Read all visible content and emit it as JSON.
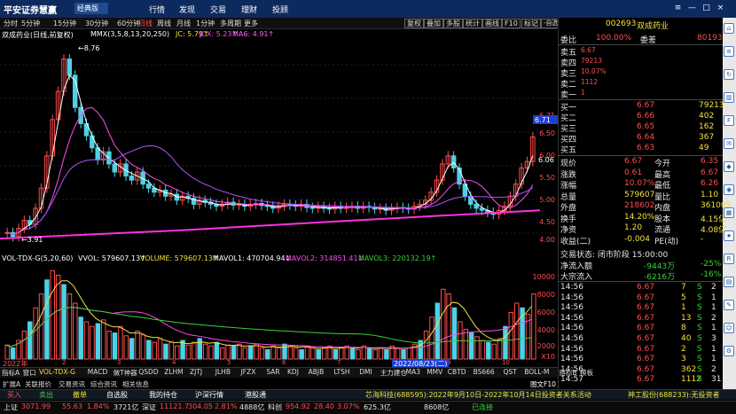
{
  "app": {
    "title": "平安证券慧赢",
    "edition": "经典版",
    "nav": [
      "行情",
      "发现",
      "交易",
      "理财",
      "投顾"
    ],
    "window_buttons": [
      "≡",
      "—",
      "□",
      "×"
    ]
  },
  "toolbar": {
    "periods": [
      "分时",
      "5分钟",
      "15分钟",
      "30分钟",
      "60分钟",
      "日线",
      "周线",
      "月线",
      "1分钟",
      "多周期",
      "更多"
    ],
    "active": "日线",
    "right": [
      "复权",
      "叠加",
      "多股",
      "统计",
      "画线",
      "F10",
      "标记",
      "-自选"
    ]
  },
  "chart_header": {
    "name": "双成药业(日线,前复权)",
    "mmx": "MMX(3,5,8,13,20,250)",
    "jc": "JC: 5.79↑",
    "jcx": "JCX: 5.23↑",
    "ma6": "MA6: 4.91↑"
  },
  "price_axis": [
    "6.71",
    "6.50",
    "6.00",
    "5.50",
    "5.00",
    "4.50",
    "4.00"
  ],
  "price_axis_badge": "6.71",
  "annotations": {
    "high": "8.76",
    "low": "3.91",
    "last": "6.06"
  },
  "vol_header": {
    "name": "VOL-TDX-G(5,20,60)",
    "vvol": "VVOL: 579607.13↑",
    "volume": "VOLUME: 579607.13↑",
    "mavol1": "MAVOL1: 470704.94↓",
    "mavol2": "MAVOL2: 314851.41↓",
    "mavol3": "MAVOL3: 220132.19↑"
  },
  "vol_axis": [
    "10000",
    "8000",
    "6000",
    "4000",
    "2000",
    "X10"
  ],
  "date_axis": {
    "left": "2022年",
    "highlight": "2022/08/23(二)",
    "marks": [
      "2",
      "3",
      "4",
      "5",
      "6",
      "7",
      "8",
      "9",
      "10"
    ]
  },
  "bottom_tabs": [
    "指标A",
    "窗口",
    "VOL-TDX-G",
    "MACD",
    "做T神器",
    "QSDD",
    "ZLHM",
    "ZJTJ",
    "JLHB",
    "JFZX",
    "SAR",
    "KDJ",
    "ABJB",
    "LTSH",
    "DMI",
    "主力建仓",
    "MA3",
    "MMV",
    "CBTD",
    "BS666",
    "QST",
    "BOLL-M",
    "指标B",
    "模板"
  ],
  "bottom_tabs_right": [
    "日线",
    "图文F10",
    "新闻舆情"
  ],
  "sub_tabs": [
    "扩展A",
    "关联报价",
    "交易资讯",
    "综合资讯",
    "相关信息"
  ],
  "quote": {
    "code": "002693",
    "name": "双成药业",
    "weibi_label": "委比",
    "weibi": "100.00%",
    "weicha_label": "委差",
    "weicha": "80193",
    "sell_labels": [
      "卖五",
      "卖四",
      "卖三",
      "卖二",
      "卖一"
    ],
    "sell_side": [
      "6.67",
      "79213",
      "10.07%",
      "1112",
      "1"
    ],
    "buy": [
      {
        "label": "买一",
        "price": "6.67",
        "vol": "79213"
      },
      {
        "label": "买二",
        "price": "6.66",
        "vol": "402"
      },
      {
        "label": "买三",
        "price": "6.65",
        "vol": "162"
      },
      {
        "label": "买四",
        "price": "6.64",
        "vol": "367"
      },
      {
        "label": "买五",
        "price": "6.63",
        "vol": "49"
      }
    ],
    "stats": [
      {
        "l1": "现价",
        "v1": "6.67",
        "l2": "今开",
        "v2": "6.35"
      },
      {
        "l1": "涨跌",
        "v1": "0.61",
        "l2": "最高",
        "v2": "6.67"
      },
      {
        "l1": "涨幅",
        "v1": "10.07%",
        "l2": "最低",
        "v2": "6.26"
      },
      {
        "l1": "总量",
        "v1": "579607",
        "l2": "量比",
        "v2": "1.10"
      },
      {
        "l1": "外盘",
        "v1": "218602",
        "l2": "内盘",
        "v2": "361005"
      },
      {
        "l1": "换手",
        "v1": "14.20%",
        "l2": "股本",
        "v2": "4.15亿"
      },
      {
        "l1": "净资",
        "v1": "1.20",
        "l2": "流通",
        "v2": "4.08亿"
      },
      {
        "l1": "收益(二)",
        "v1": "-0.004",
        "l2": "PE(动)",
        "v2": "-"
      }
    ],
    "trade_state": "交易状态: 闭市阶段 15:00:00",
    "net_inflow_label": "净流入额",
    "net_inflow": "-9443万",
    "net_inflow_pct": "-25%",
    "big_inflow_label": "大宗流入",
    "big_inflow": "-6216万",
    "big_inflow_pct": "-16%",
    "ticks": [
      [
        "14:56",
        "6.67",
        "7",
        "S",
        "2"
      ],
      [
        "14:56",
        "6.67",
        "5",
        "S",
        "1"
      ],
      [
        "14:56",
        "6.67",
        "1",
        "S",
        "1"
      ],
      [
        "14:56",
        "6.67",
        "13",
        "S",
        "2"
      ],
      [
        "14:56",
        "6.67",
        "8",
        "S",
        "1"
      ],
      [
        "14:56",
        "6.67",
        "40",
        "S",
        "3"
      ],
      [
        "14:56",
        "6.67",
        "2",
        "S",
        "1"
      ],
      [
        "14:56",
        "6.67",
        "3",
        "S",
        "1"
      ],
      [
        "14:56",
        "6.67",
        "362",
        "S",
        "2"
      ],
      [
        "14:57",
        "6.67",
        "1112",
        "S",
        "31"
      ]
    ]
  },
  "menu": {
    "items": [
      "买入",
      "卖出",
      "撤单",
      "自选股",
      "我的持仓",
      "沪深行情",
      "港股通"
    ],
    "ticker": "芯海科技(688595):2022年9月10日-2022年10月14日投资者关系活动",
    "ticker2": "神工股份(688233):无投资者"
  },
  "status": {
    "sh_label": "上证",
    "sh": "3071.99",
    "sh_chg": "55.63",
    "sh_pct": "1.84%",
    "sh_amt": "3721亿",
    "sz_label": "深证",
    "sz": "11121.7",
    "sz_chg": "304.05",
    "sz_pct": "2.81%",
    "sz_amt": "4888亿",
    "kc_label": "科创",
    "kc": "954.92",
    "kc_chg": "28.40",
    "kc_pct": "3.07%",
    "kc_amt": "625.3亿",
    "cy": "8608亿",
    "conn": "已连接"
  },
  "colors": {
    "up": "#ff4d4d",
    "down": "#3ad13a",
    "bg": "#000000",
    "panel": "#0d2a5e"
  }
}
